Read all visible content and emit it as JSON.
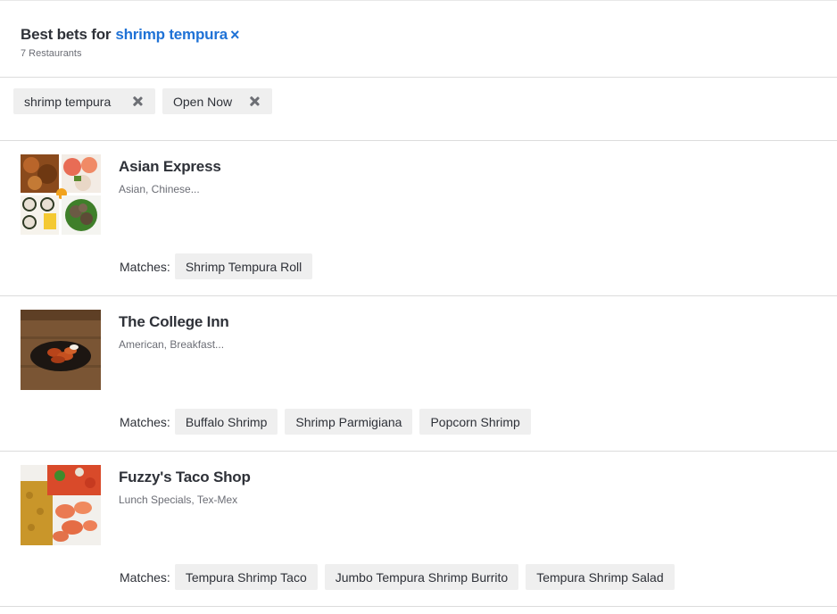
{
  "header": {
    "title_prefix": "Best bets for",
    "query": "shrimp tempura",
    "clear_glyph": "×",
    "count_text": "7 Restaurants"
  },
  "filters": [
    {
      "label": "shrimp tempura"
    },
    {
      "label": "Open Now"
    }
  ],
  "results": [
    {
      "name": "Asian Express",
      "cuisine": "Asian, Chinese...",
      "matches_label": "Matches:",
      "matches": [
        "Shrimp Tempura Roll"
      ]
    },
    {
      "name": "The College Inn",
      "cuisine": "American, Breakfast...",
      "matches_label": "Matches:",
      "matches": [
        "Buffalo Shrimp",
        "Shrimp Parmigiana",
        "Popcorn Shrimp"
      ]
    },
    {
      "name": "Fuzzy's Taco Shop",
      "cuisine": "Lunch Specials, Tex-Mex",
      "matches_label": "Matches:",
      "matches": [
        "Tempura Shrimp Taco",
        "Jumbo Tempura Shrimp Burrito",
        "Tempura Shrimp Salad"
      ]
    }
  ],
  "colors": {
    "accent": "#1f72d6",
    "text": "#2e3138",
    "muted": "#6b6d75",
    "chip_bg": "#efefef",
    "divider": "#dcdcdc"
  }
}
